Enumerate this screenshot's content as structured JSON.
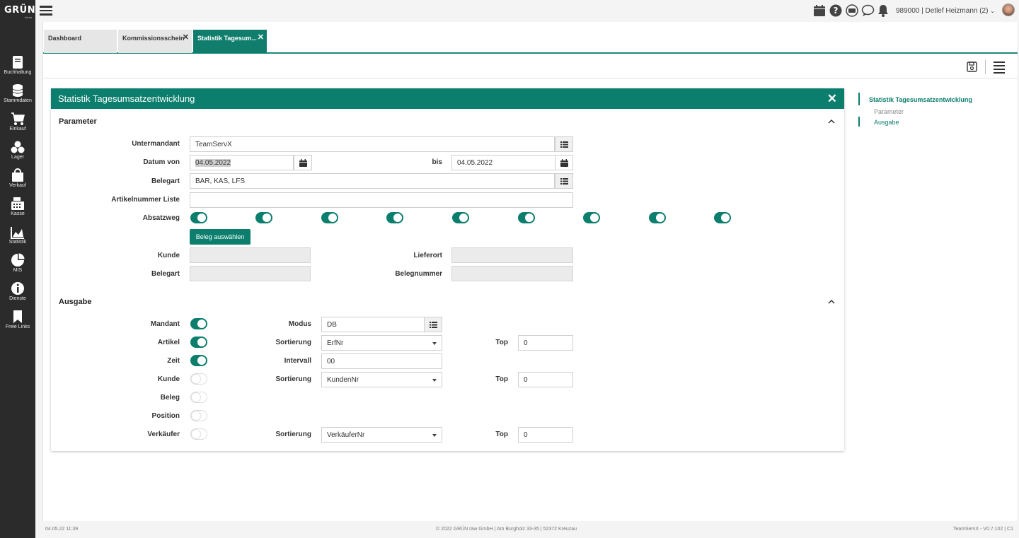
{
  "app": {
    "logo": "GRÜN",
    "logo_sub": "future"
  },
  "sidebar": {
    "items": [
      {
        "label": "Buchhaltung",
        "icon": "book-icon"
      },
      {
        "label": "Stammdaten",
        "icon": "database-icon"
      },
      {
        "label": "Einkauf",
        "icon": "cart-icon"
      },
      {
        "label": "Lager",
        "icon": "boxes-icon"
      },
      {
        "label": "Verkauf",
        "icon": "shopping-bag-icon"
      },
      {
        "label": "Kasse",
        "icon": "cash-register-icon"
      },
      {
        "label": "Statistik",
        "icon": "area-chart-icon"
      },
      {
        "label": "MIS",
        "icon": "pie-chart-icon"
      },
      {
        "label": "Dienste",
        "icon": "info-icon"
      },
      {
        "label": "Freie Links",
        "icon": "bookmark-icon"
      }
    ]
  },
  "topbar": {
    "user": "989000 | Detlef Heizmann (2)"
  },
  "tabs": [
    {
      "label": "Dashboard",
      "closable": false
    },
    {
      "label": "Kommissionsschein",
      "closable": true
    },
    {
      "label": "Statistik Tagesum...",
      "closable": true,
      "active": true
    }
  ],
  "panel": {
    "title": "Statistik Tagesumsatzentwicklung",
    "parameter": {
      "title": "Parameter",
      "untermandant_label": "Untermandant",
      "untermandant_value": "TeamServX",
      "datum_von_label": "Datum von",
      "datum_von_value": "04.05.2022",
      "bis_label": "bis",
      "bis_value": "04.05.2022",
      "belegart_label": "Belegart",
      "belegart_value": "BAR, KAS, LFS",
      "artikelnummer_label": "Artikelnummer Liste",
      "artikelnummer_value": "",
      "absatzweg_label": "Absatzweg",
      "absatzweg_toggles": [
        true,
        true,
        true,
        true,
        true,
        true,
        true,
        true,
        true
      ],
      "beleg_button": "Beleg auswählen",
      "kunde_label": "Kunde",
      "lieferort_label": "Lieferort",
      "belegart2_label": "Belegart",
      "belegnummer_label": "Belegnummer"
    },
    "ausgabe": {
      "title": "Ausgabe",
      "rows": [
        {
          "label": "Mandant",
          "on": true
        },
        {
          "label": "Artikel",
          "on": true
        },
        {
          "label": "Zeit",
          "on": true
        },
        {
          "label": "Kunde",
          "on": false
        },
        {
          "label": "Beleg",
          "on": false
        },
        {
          "label": "Position",
          "on": false
        },
        {
          "label": "Verkäufer",
          "on": false
        }
      ],
      "modus_label": "Modus",
      "modus_value": "DB",
      "sort_label": "Sortierung",
      "artikel_sort": "ErfNr",
      "intervall_label": "Intervall",
      "intervall_value": "00",
      "kunde_sort": "KundenNr",
      "verkaeufer_sort": "VerkäuferNr",
      "top_label": "Top",
      "top_value": "0"
    }
  },
  "right_nav": {
    "title": "Statistik Tagesumsatzentwicklung",
    "items": [
      "Parameter",
      "Ausgabe"
    ]
  },
  "footer": {
    "datetime": "04.05.22 11:39",
    "copyright": "© 2022 GRÜN raw GmbH | Am Burgholz 33-35 | 52372 Kreuzau",
    "version": "TeamServX - V0.7.102 | C1"
  },
  "colors": {
    "accent": "#0b7e6d",
    "sidebar": "#2b2b2b"
  }
}
